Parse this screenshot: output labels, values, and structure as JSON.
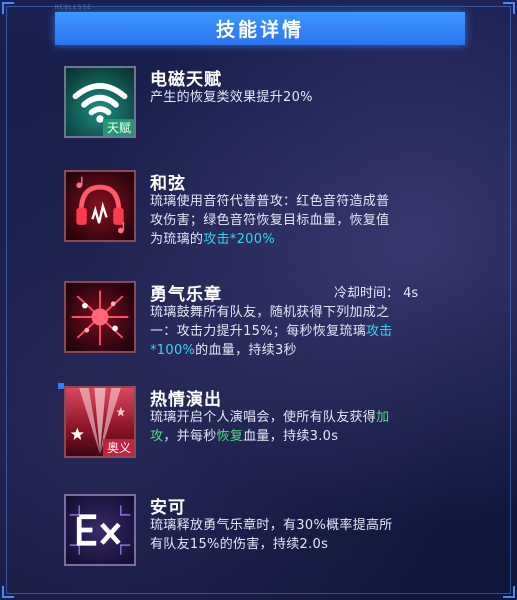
{
  "header": {
    "title": "技能详情",
    "code": "HCOLLSSE"
  },
  "skills": [
    {
      "name": "电磁天赋",
      "tag": "天赋",
      "icon": "wifi-signal-icon",
      "desc": [
        "产生的恢复类效果提升20%"
      ]
    },
    {
      "name": "和弦",
      "icon": "headphones-notes-icon",
      "desc": [
        "琉璃使用音符代替普攻：红色音符造成普",
        "攻伤害；绿色音符恢复目标血量，恢复值",
        "为琉璃的"
      ],
      "desc_hl": "攻击*200%"
    },
    {
      "name": "勇气乐章",
      "cooldown": "冷却时间： 4s",
      "icon": "music-burst-icon",
      "desc1": "琉璃鼓舞所有队友，随机获得下列加成之",
      "desc2": "一：攻击力提升15%；每秒恢复琉璃",
      "desc2_hl": "攻击",
      "desc3_hl": "*100%",
      "desc3": "的血量，持续3秒"
    },
    {
      "name": "热情演出",
      "tag": "奥义",
      "icon": "stage-spotlight-icon",
      "desc1": "琉璃开启个人演唱会，使所有队友获得",
      "desc1_hl": "加",
      "desc2_hl": "攻",
      "desc2a": "，并每秒",
      "desc2_hl2": "恢复",
      "desc2b": "血量，持续3.0s"
    },
    {
      "name": "安可",
      "icon": "ex-letters-icon",
      "desc": [
        "琉璃释放勇气乐章时，有30%概率提高所",
        "有队友15%的伤害，持续2.0s"
      ]
    }
  ],
  "colors": {
    "accent": "#2b74f0",
    "highlight_cyan": "#32d7f0",
    "highlight_green": "#4fe07a"
  }
}
